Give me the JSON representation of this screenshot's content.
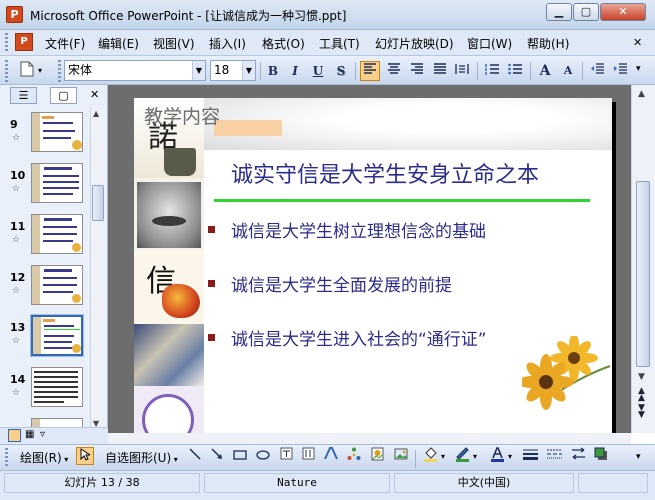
{
  "window": {
    "title": "Microsoft Office PowerPoint - [让诚信成为一种习惯.ppt]",
    "app_icon_letter": "P",
    "minimize": "▁",
    "restore": "▢",
    "close": "✕"
  },
  "menu": {
    "doc_icon_letter": "P",
    "items": [
      "文件(F)",
      "编辑(E)",
      "视图(V)",
      "插入(I)",
      "格式(O)",
      "工具(T)",
      "幻灯片放映(D)",
      "窗口(W)",
      "帮助(H)"
    ],
    "close_doc": "✕"
  },
  "toolbar": {
    "font_name": "宋体",
    "font_size": "18",
    "bold": "B",
    "italic": "I",
    "underline": "U",
    "shadow": "S",
    "increase_font": "A",
    "decrease_font": "A"
  },
  "left_pane": {
    "tab_outline": "☰",
    "tab_slides": "▢",
    "close": "✕",
    "slides": [
      {
        "number": "9"
      },
      {
        "number": "10"
      },
      {
        "number": "11"
      },
      {
        "number": "12"
      },
      {
        "number": "13",
        "selected": true
      },
      {
        "number": "14"
      }
    ]
  },
  "slide": {
    "label": "教学内容",
    "title": "诚实守信是大学生安身立命之本",
    "bullets": [
      "诚信是大学生树立理想信念的基础",
      "诚信是大学生全面发展的前提",
      "诚信是大学生进入社会的“通行证”"
    ],
    "calligraphy_1": "諾",
    "calligraphy_2": "信",
    "accent_color": "#2c2c8c",
    "line_color": "#2fd42f"
  },
  "drawing_toolbar": {
    "draw_label": "绘图(R)",
    "autoshapes_label": "自选图形(U)"
  },
  "status": {
    "slide_info": "幻灯片 13 / 38",
    "design": "Nature",
    "language": "中文(中国)"
  }
}
